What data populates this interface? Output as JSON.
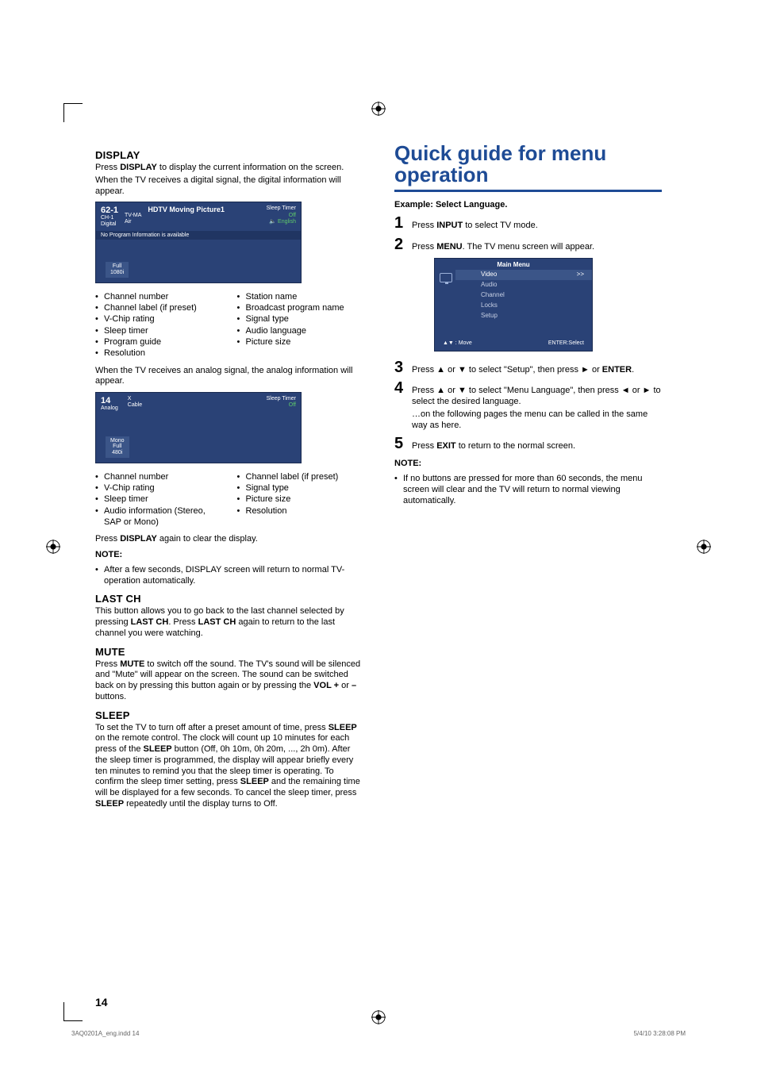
{
  "page_number": "14",
  "footer_file": "3AQ0201A_eng.indd   14",
  "footer_time": "5/4/10   3:28:08 PM",
  "left": {
    "display": {
      "heading": "DISPLAY",
      "p1a": "Press ",
      "p1b": "DISPLAY",
      "p1c": " to display the current information on the screen.",
      "p2": "When the TV receives a digital signal, the digital information will appear.",
      "osd1": {
        "ch_num": "62-1",
        "ch_sub1": "CH-1",
        "ch_sub2": "Digital",
        "rating": "TV-MA",
        "signal": "Air",
        "prog": "HDTV Moving Picture1",
        "sleep_label": "Sleep Timer",
        "sleep_val": "Off",
        "lang": "English",
        "bar": "No Program Information is available",
        "footer1": "Full",
        "footer2": "1080i"
      },
      "list1_left": [
        "Channel number",
        "Channel label (if preset)",
        "V-Chip rating",
        "Sleep timer",
        "Program guide",
        "Resolution"
      ],
      "list1_right": [
        "Station name",
        "Broadcast program name",
        "Signal type",
        "Audio language",
        "Picture size"
      ],
      "p3": "When the TV receives an analog signal, the analog information will appear.",
      "osd2": {
        "ch_num": "14",
        "ch_sub": "Analog",
        "rating": "X",
        "signal": "Cable",
        "sleep_label": "Sleep Timer",
        "sleep_val": "Off",
        "footer1": "Mono",
        "footer2": "Full",
        "footer3": "480i"
      },
      "list2_left": [
        "Channel number",
        "V-Chip rating",
        "Sleep timer",
        "Audio information (Stereo, SAP or Mono)"
      ],
      "list2_right": [
        "Channel label (if preset)",
        "Signal type",
        "Picture size",
        "Resolution"
      ],
      "p4a": "Press ",
      "p4b": "DISPLAY",
      "p4c": " again to clear the display.",
      "note_head": "NOTE:",
      "note1": "After a few seconds, DISPLAY screen will return to normal TV-operation automatically."
    },
    "lastch": {
      "heading": "LAST CH",
      "p1a": "This button allows you to go back to the last channel selected by pressing ",
      "p1b": "LAST CH",
      "p1c": ". Press ",
      "p1d": "LAST CH",
      "p1e": " again to return to the last channel you were watching."
    },
    "mute": {
      "heading": "MUTE",
      "p1a": "Press ",
      "p1b": "MUTE",
      "p1c": " to switch off the sound. The TV's sound will be silenced and \"Mute\" will appear on the screen. The sound can be switched back on by pressing this button again or by pressing the ",
      "p1d": "VOL +",
      "p1e": " or ",
      "p1f": "–",
      "p1g": " buttons."
    },
    "sleep": {
      "heading": "SLEEP",
      "p1a": "To set the TV to turn off after a preset amount of time, press ",
      "p1b": "SLEEP",
      "p1c": " on the remote control. The clock will count up 10 minutes for each press of the ",
      "p1d": "SLEEP",
      "p1e": " button (Off, 0h 10m, 0h 20m, ..., 2h 0m). After the sleep timer is programmed, the display will appear briefly every ten minutes to remind you that the sleep timer is operating. To confirm the sleep timer setting, press ",
      "p1f": "SLEEP",
      "p1g": " and the remaining time will be displayed for a few seconds. To cancel the sleep timer, press ",
      "p1h": "SLEEP",
      "p1i": " repeatedly until the display turns to Off."
    }
  },
  "right": {
    "title": "Quick guide for menu operation",
    "example": "Example: Select Language.",
    "steps": {
      "s1a": "Press ",
      "s1b": "INPUT",
      "s1c": " to select TV mode.",
      "s2a": "Press ",
      "s2b": "MENU",
      "s2c": ". The TV menu screen will appear.",
      "s3a": "Press ▲ or ▼ to select \"Setup\", then press ► or ",
      "s3b": "ENTER",
      "s3c": ".",
      "s4a": "Press ▲ or ▼ to select \"Menu Language\", then press ◄ or ► to select the desired language.",
      "s4b": "…on the following pages the menu can be called in the same way as here.",
      "s5a": "Press ",
      "s5b": "EXIT",
      "s5c": " to return to the normal screen."
    },
    "menu": {
      "title": "Main Menu",
      "items": [
        "Video",
        "Audio",
        "Channel",
        "Locks",
        "Setup"
      ],
      "arrow": ">>",
      "foot_left": "▲▼ : Move",
      "foot_right": "ENTER:Select"
    },
    "note_head": "NOTE:",
    "note1": "If no buttons are pressed for more than 60 seconds, the menu screen will clear and the TV will return to normal viewing automatically."
  }
}
